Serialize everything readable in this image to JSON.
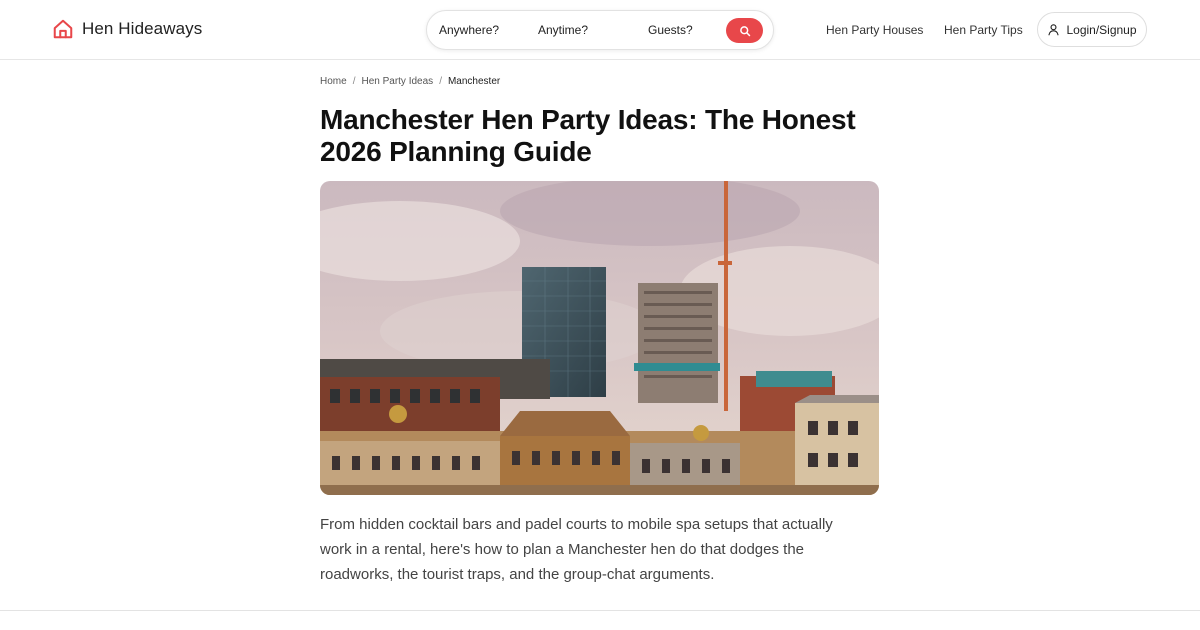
{
  "brand": {
    "name": "Hen Hideaways",
    "accent": "#e8474a"
  },
  "search": {
    "where": "Anywhere?",
    "when": "Anytime?",
    "guests": "Guests?",
    "button_icon": "search-icon"
  },
  "nav": {
    "houses": "Hen Party Houses",
    "tips": "Hen Party Tips",
    "login": "Login/Signup",
    "login_icon": "user-icon"
  },
  "breadcrumb": {
    "items": [
      "Home",
      "Hen Party Ideas",
      "Manchester"
    ],
    "separator": "/"
  },
  "article": {
    "title": "Manchester Hen Party Ideas: The Honest 2026 Planning Guide",
    "hero_image": "Manchester skyline with Victorian rooftops, modern towers and a crane under a cloudy sky",
    "intro": "From hidden cocktail bars and padel courts to mobile spa setups that actually work in a rental, here's how to plan a Manchester hen do that dodges the roadworks, the tourist traps, and the group-chat arguments."
  }
}
